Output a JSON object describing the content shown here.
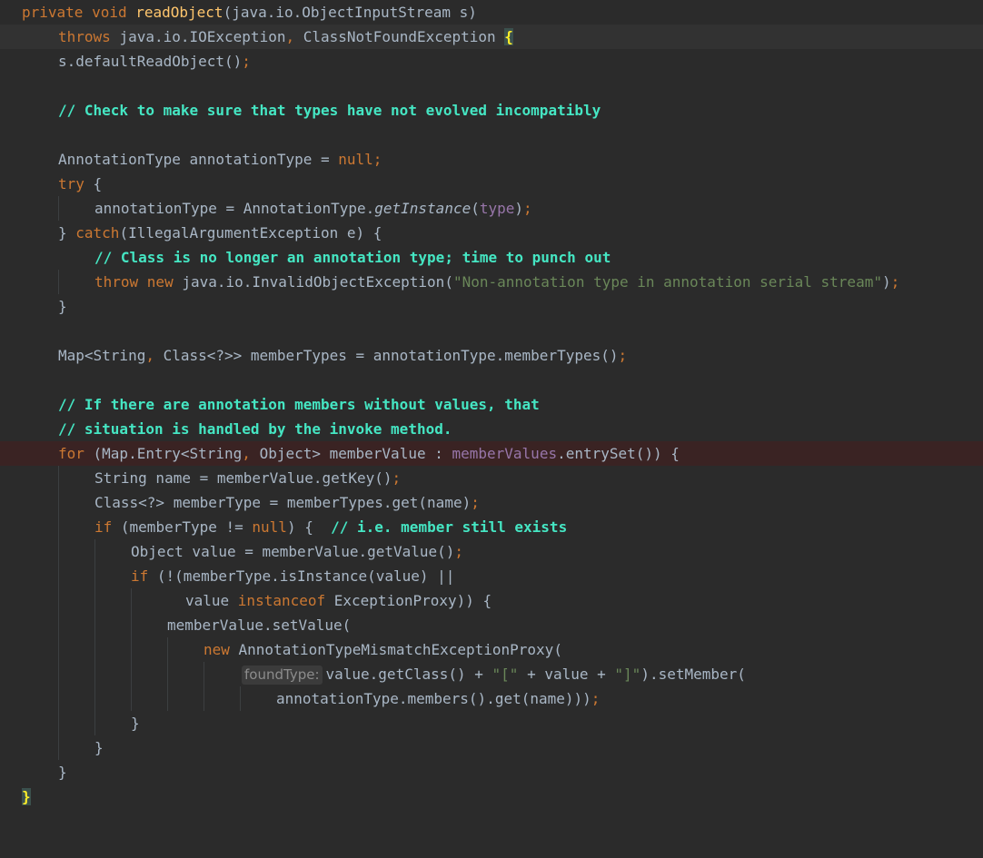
{
  "editor": {
    "language": "Java",
    "method_name": "readObject",
    "lines": [
      "private void readObject(java.io.ObjectInputStream s)",
      "    throws java.io.IOException, ClassNotFoundException {",
      "    s.defaultReadObject();",
      "",
      "    // Check to make sure that types have not evolved incompatibly",
      "",
      "    AnnotationType annotationType = null;",
      "    try {",
      "        annotationType = AnnotationType.getInstance(type);",
      "    } catch(IllegalArgumentException e) {",
      "        // Class is no longer an annotation type; time to punch out",
      "        throw new java.io.InvalidObjectException(\"Non-annotation type in annotation serial stream\");",
      "    }",
      "",
      "    Map<String, Class<?>> memberTypes = annotationType.memberTypes();",
      "",
      "    // If there are annotation members without values, that",
      "    // situation is handled by the invoke method.",
      "    for (Map.Entry<String, Object> memberValue : memberValues.entrySet()) {",
      "        String name = memberValue.getKey();",
      "        Class<?> memberType = memberTypes.get(name);",
      "        if (memberType != null) {  // i.e. member still exists",
      "            Object value = memberValue.getValue();",
      "            if (!(memberType.isInstance(value) ||",
      "                  value instanceof ExceptionProxy)) {",
      "                memberValue.setValue(",
      "                    new AnnotationTypeMismatchExceptionProxy(",
      "                        value.getClass() + \"[\" + value + \"]\").setMember(",
      "                            annotationType.members().get(name)));",
      "            }",
      "        }",
      "    }",
      "}"
    ],
    "inlay_hint": "foundType:",
    "caret_line": 2,
    "breakpoint_line": 19
  },
  "colors": {
    "background": "#2b2b2b",
    "text": "#a9b7c6",
    "keyword": "#cc7832",
    "method_declaration": "#ffc66d",
    "string": "#6a8759",
    "field": "#9876aa",
    "comment": "#45e6c3",
    "brace_match": "#ffef28",
    "breakpoint_row": "#3a2323",
    "caret_row": "#323232"
  }
}
